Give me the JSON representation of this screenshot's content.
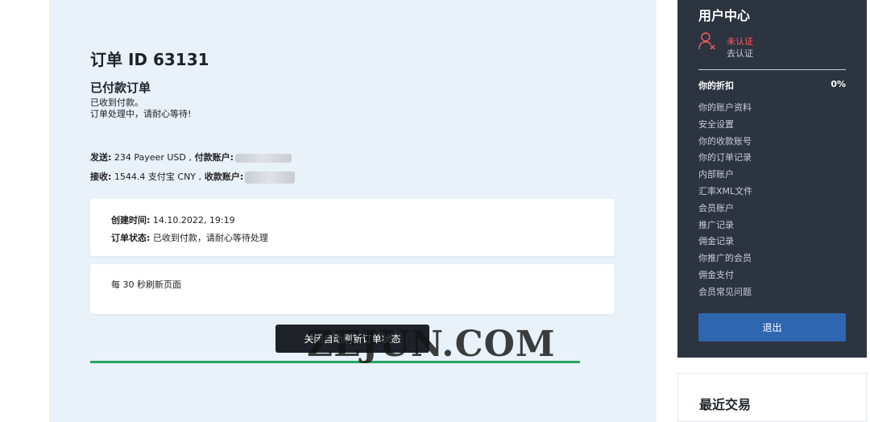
{
  "order": {
    "title": "订单 ID 63131",
    "paid_title": "已付款订单",
    "paid_line1": "已收到付款。",
    "paid_line2": "订单处理中，请耐心等待!"
  },
  "transaction": {
    "send_label": "发送:",
    "send_value": " 234 Payeer USD ,",
    "send_account_label": " 付款账户:",
    "recv_label": "接收:",
    "recv_value": " 1544.4 支付宝 CNY ,",
    "recv_account_label": " 收款账户:"
  },
  "info_card": {
    "created_label": "创建时间:",
    "created_value": " 14.10.2022, 19:19",
    "status_label": "订单状态:",
    "status_value": " 已收到付款，请耐心等待处理"
  },
  "refresh_card": {
    "text": "每 30 秒刷新页面"
  },
  "stop_refresh_label": "关闭自动刷新订单状态",
  "watermark": "ZEJUN.COM",
  "user_center": {
    "title": "用户中心",
    "unverified": "未认证",
    "go_verify": "去认证",
    "discount_label": "你的折扣",
    "discount_value": "0%",
    "menu": [
      "你的账户资料",
      "安全设置",
      "你的收款账号",
      "你的订单记录",
      "内部账户",
      "汇率XML文件",
      "会员账户",
      "推广记录",
      "佣金记录",
      "你推广的会员",
      "佣金支付",
      "会员常见问题"
    ],
    "logout_label": "退出"
  },
  "recent": {
    "title": "最近交易"
  },
  "colors": {
    "panel_bg": "#e9f1f9",
    "sidebar_bg": "#2c3440",
    "accent_blue": "#2f66b0",
    "progress_green": "#27a562",
    "warning_red": "#ff5a5a"
  }
}
